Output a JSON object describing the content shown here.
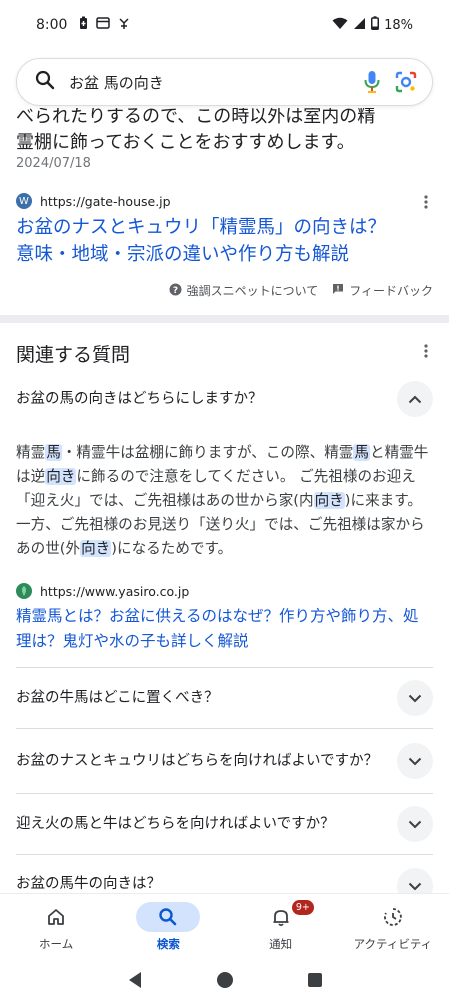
{
  "status_bar": {
    "time": "8:00",
    "battery": "18%"
  },
  "search": {
    "query": "お盆 馬の向き"
  },
  "snippet": {
    "text_cut": "べられたりするので、この時以外は室内の精",
    "text_line2": "霊棚に飾っておくことをおすすめします。",
    "date": "2024/07/18",
    "source_url": "https://gate-house.jp",
    "title_line1": "お盆のナスとキュウリ「精霊馬」の向きは？",
    "title_line2": "意味・地域・宗派の違いや作り方も解説",
    "about_label": "強調スニペットについて",
    "feedback_label": "フィードバック"
  },
  "related": {
    "title": "関連する質問",
    "q1": "お盆の馬の向きはどちらにしますか？",
    "answer": {
      "p1": "精霊",
      "h1": "馬",
      "p2": "・精霊牛は盆棚に飾りますが、この際、精霊",
      "h2": "馬",
      "p3": "と精霊牛は逆",
      "h3": "向き",
      "p4": "に飾るので注意をしてください。 ご先祖様のお迎え「迎え火」では、ご先祖様はあの世から家(内",
      "h4": "向き",
      "p5": ")に来ます。 一方、ご先祖様のお見送り「送り火」では、ご先祖様は家からあの世(外",
      "h5": "向き",
      "p6": ")になるためです。"
    },
    "answer_source_url": "https://www.yasiro.co.jp",
    "answer_link_line1": "精霊馬とは？お盆に供えるのはなぜ？作り方や飾り方、処",
    "answer_link_line2": "理は？鬼灯や水の子も詳しく解説",
    "q2": "お盆の牛馬はどこに置くべき？",
    "q3": "お盆のナスとキュウリはどちらを向ければよいですか？",
    "q4": "迎え火の馬と牛はどちらを向ければよいですか？",
    "q5": "お盆の馬牛の向きは？"
  },
  "bottom_nav": {
    "home": "ホーム",
    "search": "検索",
    "notifications": "通知",
    "notifications_badge": "9+",
    "activity": "アクティビティ"
  },
  "colors": {
    "link": "#1558d6",
    "active_pill": "#d3e3fd",
    "highlight": "#d3e3fd",
    "badge": "#b3261e"
  }
}
